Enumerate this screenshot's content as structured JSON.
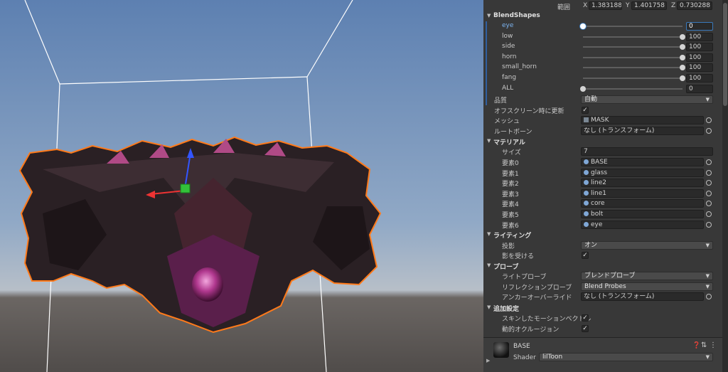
{
  "transform": {
    "label": "範囲",
    "x_label": "X",
    "x": "1.383188",
    "y_label": "Y",
    "y": "1.401758",
    "z_label": "Z",
    "z": "0.730288"
  },
  "blendshapes": {
    "title": "BlendShapes",
    "items": [
      {
        "name": "eye",
        "value": "0",
        "fraction": 0.0
      },
      {
        "name": "low",
        "value": "100",
        "fraction": 1.0
      },
      {
        "name": "side",
        "value": "100",
        "fraction": 1.0
      },
      {
        "name": "horn",
        "value": "100",
        "fraction": 1.0
      },
      {
        "name": "small_horn",
        "value": "100",
        "fraction": 1.0
      },
      {
        "name": "fang",
        "value": "100",
        "fraction": 1.0
      },
      {
        "name": "ALL",
        "value": "0",
        "fraction": 0.0
      }
    ]
  },
  "quality": {
    "label": "品質",
    "value": "自動"
  },
  "offscreen": {
    "label": "オフスクリーン時に更新"
  },
  "mesh": {
    "label": "メッシュ",
    "value": "MASK"
  },
  "rootbone": {
    "label": "ルートボーン",
    "value": "なし (トランスフォーム)"
  },
  "materials": {
    "title": "マテリアル",
    "size_label": "サイズ",
    "size": "7",
    "elements": [
      {
        "label": "要素0",
        "value": "BASE"
      },
      {
        "label": "要素1",
        "value": "glass"
      },
      {
        "label": "要素2",
        "value": "line2"
      },
      {
        "label": "要素3",
        "value": "line1"
      },
      {
        "label": "要素4",
        "value": "core"
      },
      {
        "label": "要素5",
        "value": "bolt"
      },
      {
        "label": "要素6",
        "value": "eye"
      }
    ]
  },
  "lighting": {
    "title": "ライティング",
    "cast_label": "投影",
    "cast_value": "オン",
    "receive_label": "影を受ける"
  },
  "probes": {
    "title": "プローブ",
    "light_label": "ライトプローブ",
    "light_value": "ブレンドプローブ",
    "reflection_label": "リフレクションプローブ",
    "reflection_value": "Blend Probes",
    "anchor_label": "アンカーオーバーライド",
    "anchor_value": "なし (トランスフォーム)"
  },
  "additional": {
    "title": "追加設定",
    "skinned_label": "スキンしたモーションベクトル",
    "dynamic_label": "動的オクルージョン"
  },
  "material_footer": {
    "name": "BASE",
    "shader_label": "Shader",
    "shader_value": "lilToon"
  }
}
